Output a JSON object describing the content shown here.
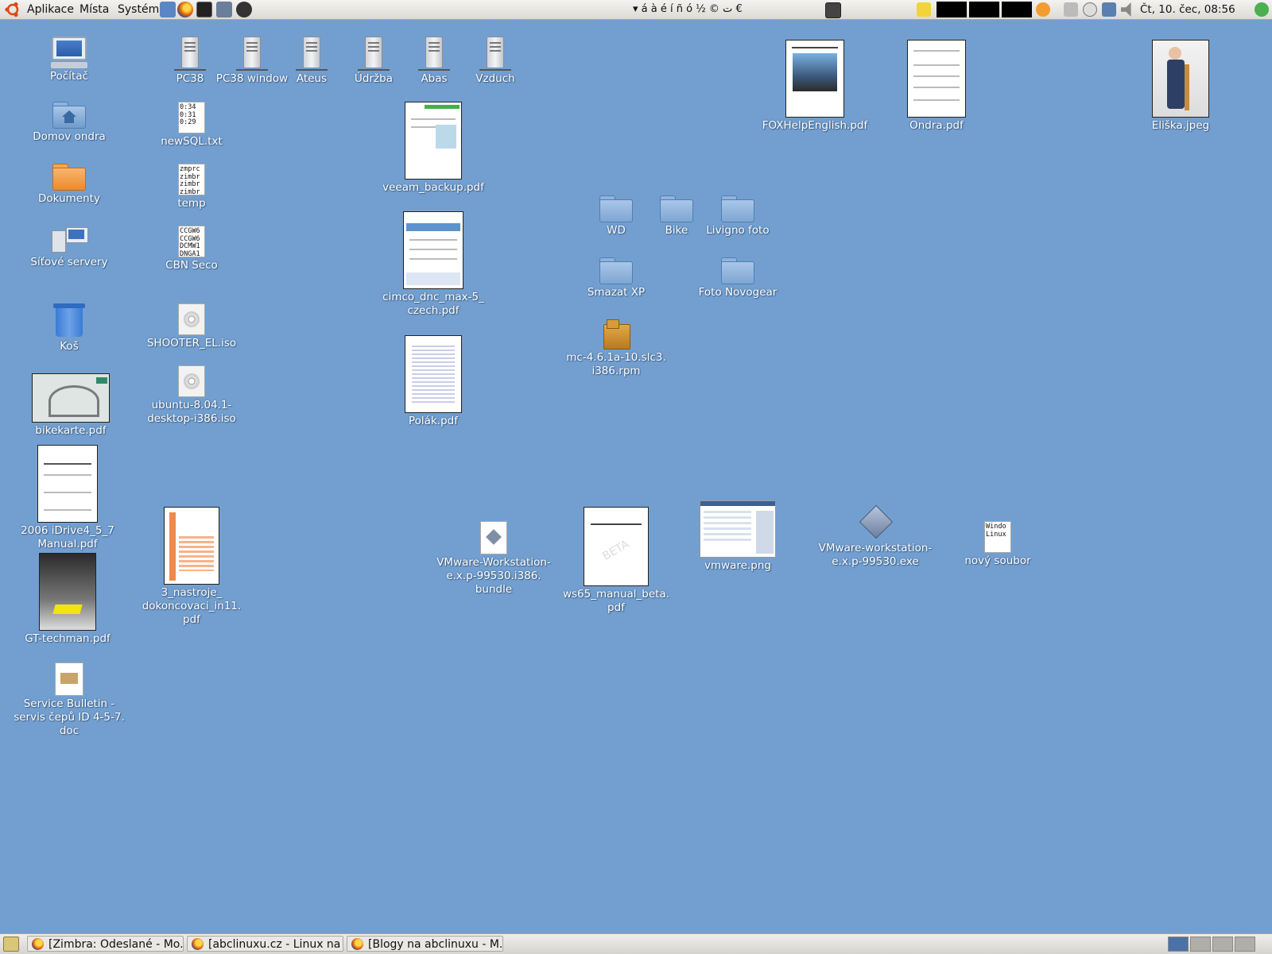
{
  "top_panel": {
    "menus": [
      "Aplikace",
      "Místa",
      "Systém"
    ],
    "launchers": [
      "home-folder-icon",
      "firefox-icon",
      "terminal-icon",
      "gimp-icon",
      "hp-icon"
    ],
    "chars": "▾  á  à  é  í  ñ  ó  ½  ©  ت  €",
    "clock": "Čt, 10. čec, 08:56"
  },
  "desktop_icons": {
    "pocitac": "Počítač",
    "domov": "Domov ondra",
    "dokumenty": "Dokumenty",
    "sitove": "Síťové servery",
    "kos": "Koš",
    "bikekarte": "bikekarte.pdf",
    "idrive": "2006 iDrive4_5_7 Manual.pdf",
    "gt": "GT-techman.pdf",
    "service": "Service Bulletin - servis čepů ID 4-5-7. doc",
    "pc38": "PC38",
    "pc38w": "PC38 window",
    "ateus": "Ateus",
    "udrzba": "Údržba",
    "abas": "Abas",
    "vzduch": "Vzduch",
    "newsql": "newSQL.txt",
    "temp": "temp",
    "cbn": "CBN Seco",
    "shooter": "SHOOTER_EL.iso",
    "ubuntu": "ubuntu-8.04.1-desktop-i386.iso",
    "nastroje": "3_nastroje_ dokoncovaci_in11. pdf",
    "veeam": "veeam_backup.pdf",
    "cimco": "cimco_dnc_max-5_ czech.pdf",
    "polak": "Polák.pdf",
    "vmbundle": "VMware-Workstation- e.x.p-99530.i386. bundle",
    "ws65": "ws65_manual_beta. pdf",
    "vmpng": "vmware.png",
    "vmexe": "VMware-workstation- e.x.p-99530.exe",
    "novy": "nový soubor",
    "wd": "WD",
    "bike": "Bike",
    "livigno": "Livigno foto",
    "smazat": "Smazat XP",
    "fotonovo": "Foto Novogear",
    "mc": "mc-4.6.1a-10.slc3. i386.rpm",
    "fox": "FOXHelpEnglish.pdf",
    "ondra": "Ondra.pdf",
    "eliska": "Eliška.jpeg"
  },
  "text_previews": {
    "newsql": "0:34\n0:31\n0:29",
    "temp": "zmprc\nzimbr\nzimbr\nzimbr",
    "cbn": "CCGW6\nCCGW6\nDCMW1\nDNGA1",
    "novy": "Windo\nLinux"
  },
  "taskbar": {
    "tasks": [
      "[Zimbra: Odeslané - Mo...",
      "[abclinuxu.cz - Linux na ...",
      "[Blogy na abclinuxu - M..."
    ],
    "workspaces": 4,
    "active_workspace": 1
  },
  "colors": {
    "desktop": "#729fcf"
  }
}
